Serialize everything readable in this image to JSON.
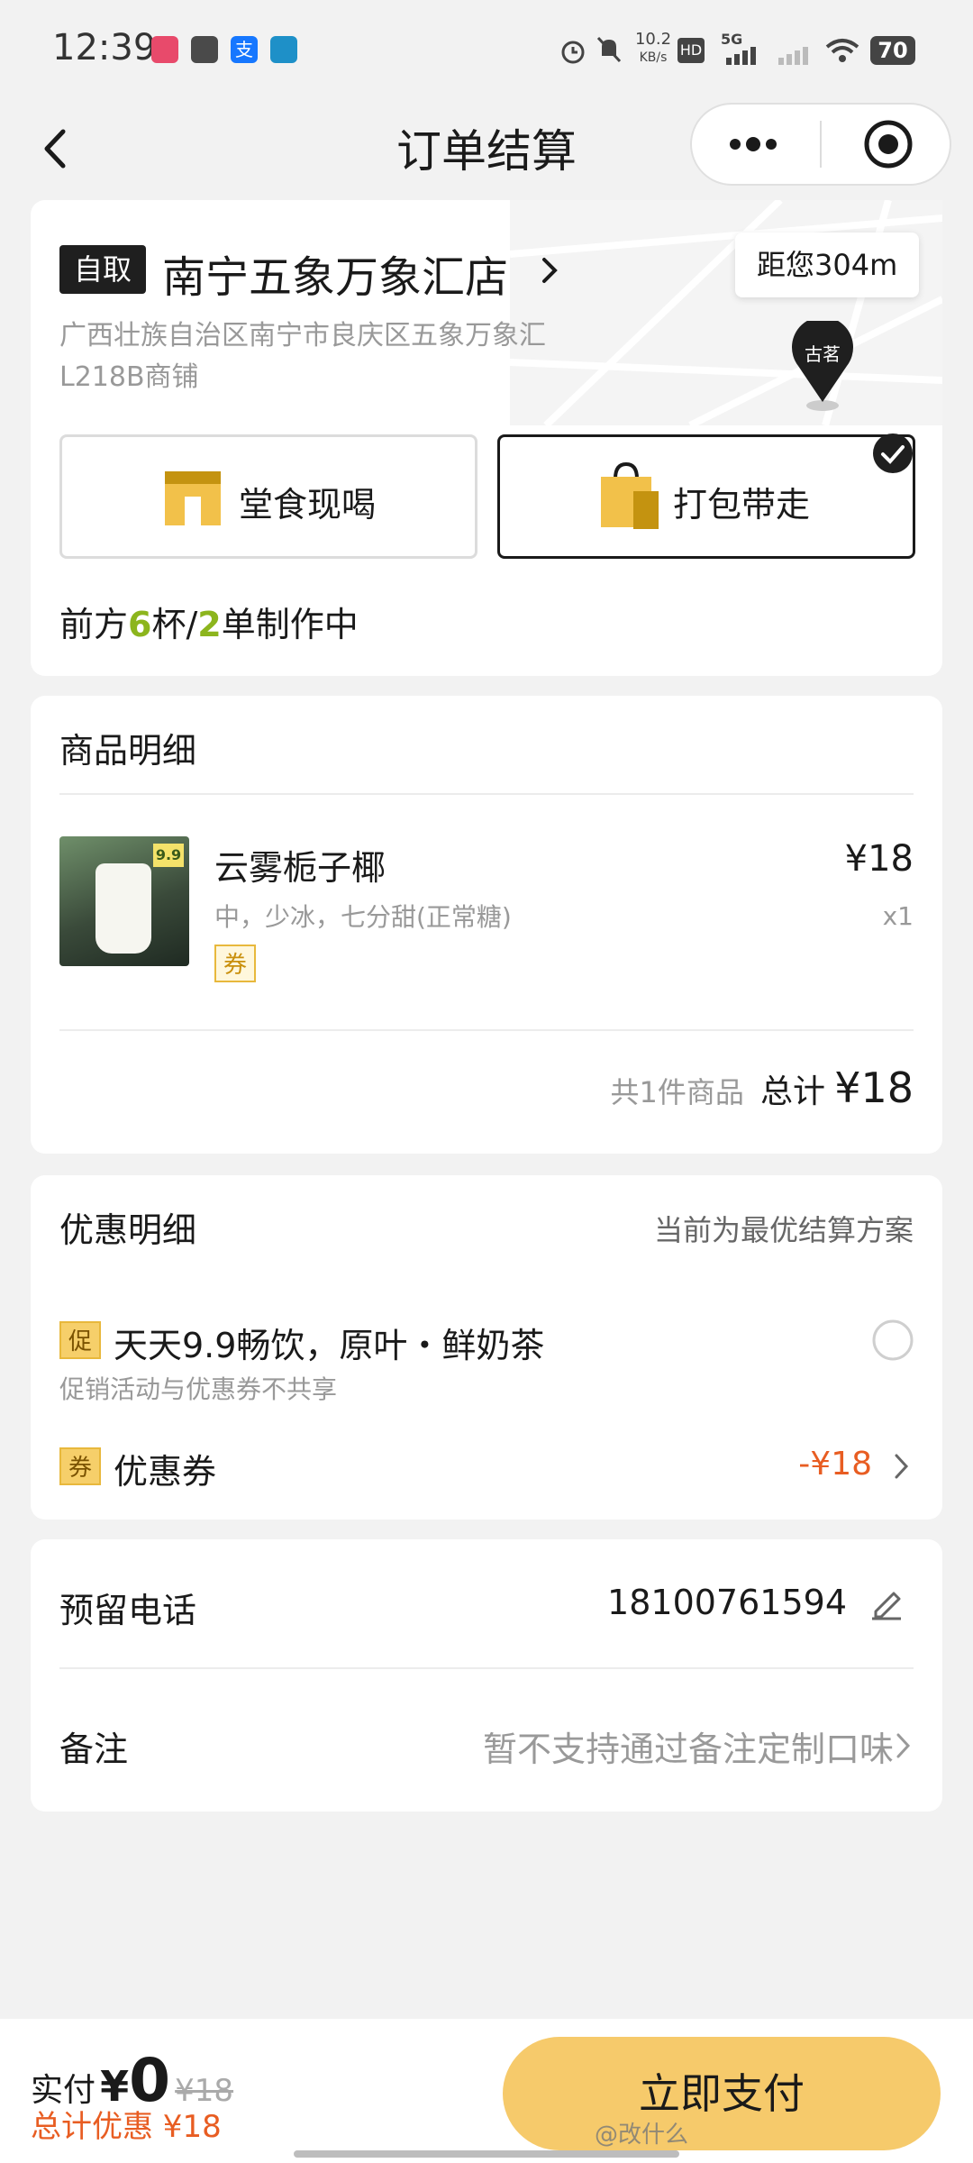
{
  "status_bar": {
    "time": "12:39",
    "net_speed": "10.2",
    "net_unit": "KB/s",
    "signal_label": "5G",
    "battery": "70"
  },
  "nav": {
    "title": "订单结算"
  },
  "store": {
    "tag": "自取",
    "name": "南宁五象万象汇店",
    "address_line1": "广西壮族自治区南宁市良庆区五象万象汇",
    "address_line2": "L218B商铺",
    "distance": "距您304m",
    "pin_label": "古茗",
    "option_dine_in": "堂食现喝",
    "option_takeaway": "打包带走",
    "queue_prefix": "前方",
    "queue_cups": "6",
    "queue_cups_unit": "杯/",
    "queue_orders": "2",
    "queue_suffix": "单制作中"
  },
  "goods": {
    "title": "商品明细",
    "thumb_badge": "9.9",
    "item_name": "云雾栀子椰",
    "item_spec": "中，少冰，七分甜(正常糖)",
    "item_price": "¥18",
    "item_qty": "x1",
    "coupon_badge": "券",
    "count_text": "共1件商品",
    "total_label": "总计",
    "total_value": "¥18"
  },
  "discount": {
    "title": "优惠明细",
    "hint": "当前为最优结算方案",
    "promo_badge": "促",
    "promo_title": "天天9.9畅饮，原叶・鲜奶茶",
    "promo_note": "促销活动与优惠券不共享",
    "coupon_badge": "券",
    "coupon_label": "优惠券",
    "coupon_value": "-¥18"
  },
  "contact": {
    "phone_label": "预留电话",
    "phone_value": "18100761594",
    "remark_label": "备注",
    "remark_placeholder": "暂不支持通过备注定制口味"
  },
  "bottom_bar": {
    "paid_label": "实付",
    "currency": "¥",
    "paid_value": "0",
    "original_price": "¥18",
    "discount_text": "总计优惠 ¥18",
    "pay_button": "立即支付",
    "watermark": "@改什么"
  },
  "colors": {
    "accent_yellow": "#f6ca6b",
    "queue_green": "#8cb51d",
    "price_red": "#e85d22"
  }
}
